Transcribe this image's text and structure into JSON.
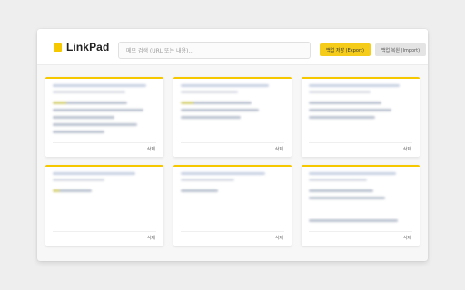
{
  "app": {
    "name": "LinkPad",
    "logo_icon": "square-logo-icon",
    "brand_color": "#f5c800"
  },
  "search": {
    "placeholder": "메모 검색 (URL 또는 내용)..."
  },
  "toolbar": {
    "export_label": "백업 저장 (Export)",
    "import_label": "백업 복원 (Import)"
  },
  "cards": [
    {
      "links": 5,
      "delete_label": "삭제"
    },
    {
      "links": 3,
      "delete_label": "삭제"
    },
    {
      "links": 3,
      "delete_label": "삭제"
    },
    {
      "links": 1,
      "delete_label": "삭제"
    },
    {
      "links": 1,
      "delete_label": "삭제"
    },
    {
      "links": 3,
      "delete_label": "삭제"
    }
  ]
}
